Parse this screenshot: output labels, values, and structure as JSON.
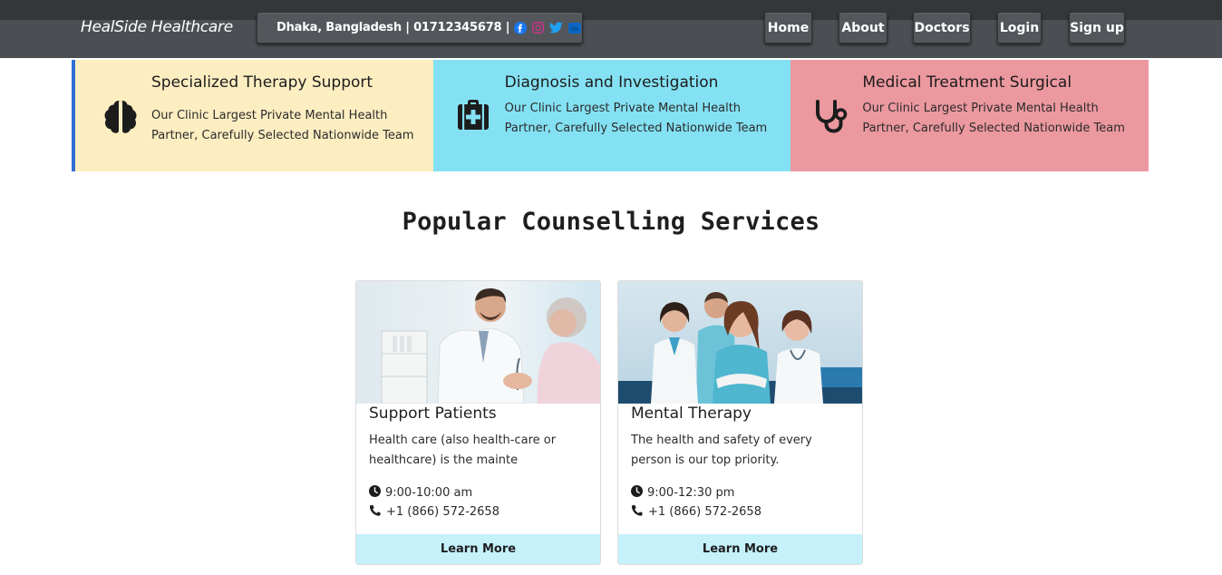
{
  "header": {
    "brand": "HealSide Healthcare",
    "contact": "Dhaka, Bangladesh | 01712345678 |",
    "social_icons": [
      "facebook-icon",
      "instagram-icon",
      "twitter-icon",
      "linkedin-icon"
    ],
    "nav": [
      "Home",
      "About",
      "Doctors",
      "Login",
      "Sign up"
    ]
  },
  "features": [
    {
      "title": "Specialized Therapy Support",
      "desc": "Our Clinic Largest Private Mental Health Partner, Carefully Selected Nationwide Team",
      "icon": "brain-icon",
      "bg": "#fdeec1"
    },
    {
      "title": "Diagnosis and Investigation",
      "desc": "Our Clinic Largest Private Mental Health Partner, Carefully Selected Nationwide Team",
      "icon": "first-aid-kit-icon",
      "bg": "#84e1f3"
    },
    {
      "title": "Medical Treatment Surgical",
      "desc": "Our Clinic Largest Private Mental Health Partner, Carefully Selected Nationwide Team",
      "icon": "stethoscope-icon",
      "bg": "#ec989f"
    }
  ],
  "section": {
    "title": "Popular Counselling Services"
  },
  "cards": [
    {
      "title": "Support Patients",
      "desc": "Health care (also health-care or healthcare) is the mainte",
      "hours": "9:00-10:00 am",
      "phone": "+1 (866) 572-2658",
      "button": "Learn More"
    },
    {
      "title": "Mental Therapy",
      "desc": "The health and safety of every person is our top priority.",
      "hours": "9:00-12:30 pm",
      "phone": "+1 (866) 572-2658",
      "button": "Learn More"
    }
  ],
  "colors": {
    "accent_border": "#2f6fd6",
    "button_bg": "#c5f1fb",
    "header_bg": "#4b4e52"
  }
}
